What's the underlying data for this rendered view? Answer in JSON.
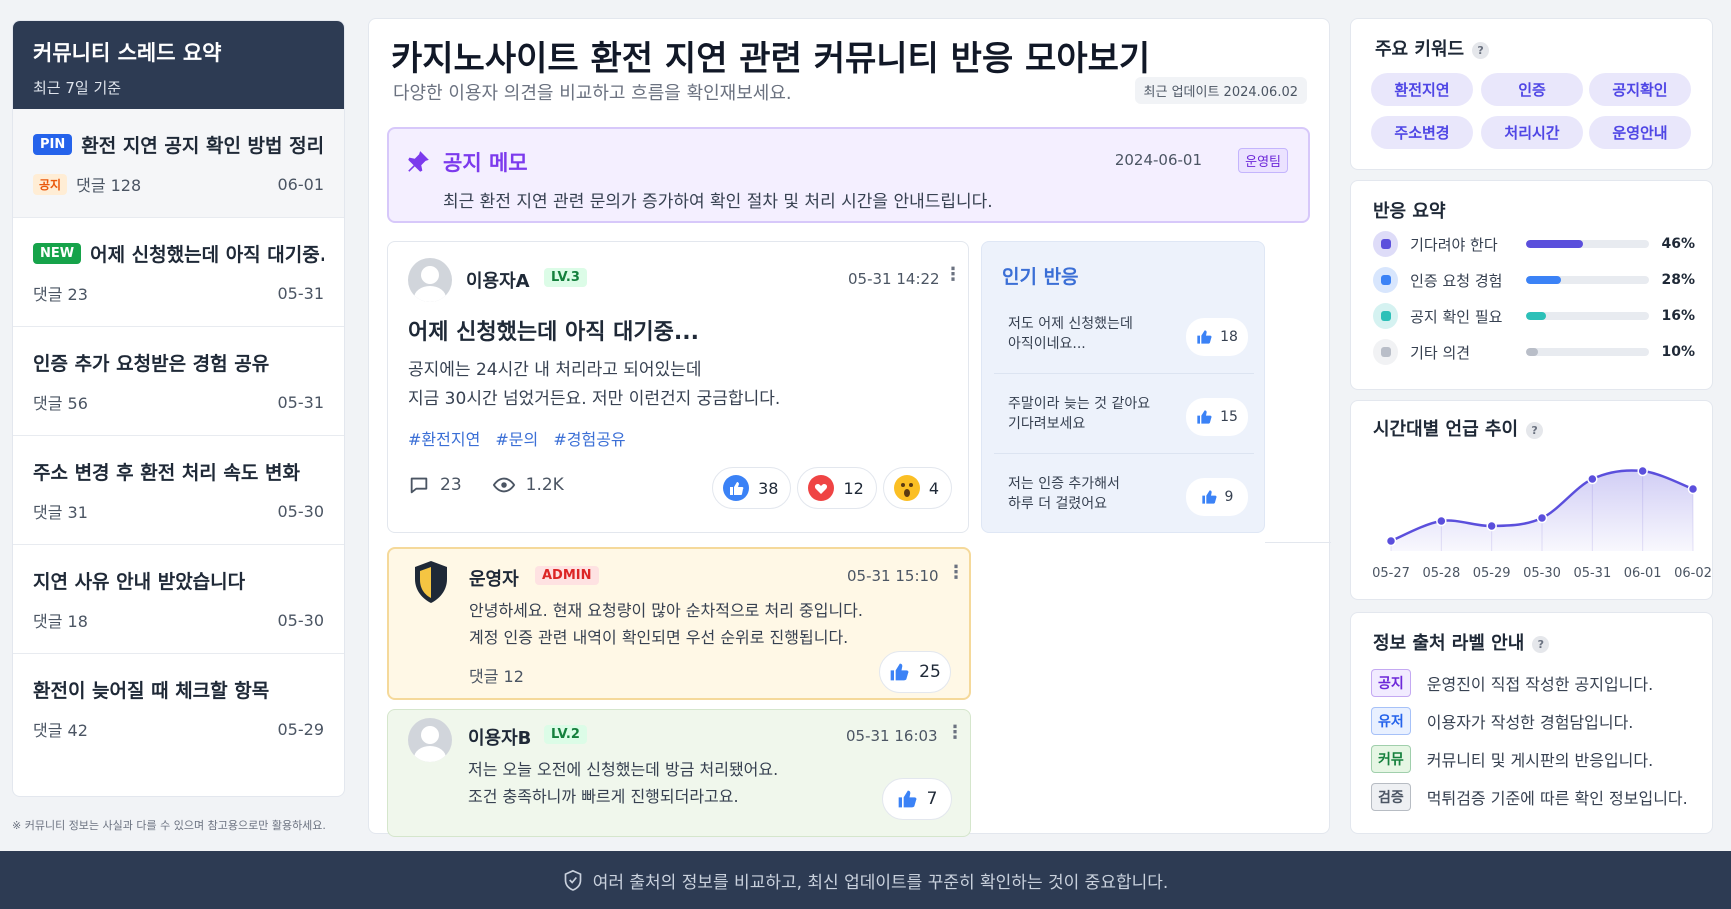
{
  "left": {
    "title": "커뮤니티 스레드 요약",
    "subtitle": "최근 7일 기준",
    "threads": [
      {
        "badge": "PIN",
        "title": "환전 지연 공지 확인 방법 정리",
        "tag": "공지",
        "comments": "댓글 128",
        "date": "06-01"
      },
      {
        "badge": "NEW",
        "title": "어제 신청했는데 아직 대기중...",
        "comments": "댓글 23",
        "date": "05-31"
      },
      {
        "title": "인증 추가 요청받은 경험 공유",
        "comments": "댓글 56",
        "date": "05-31"
      },
      {
        "title": "주소 변경 후 환전 처리 속도 변화",
        "comments": "댓글 31",
        "date": "05-30"
      },
      {
        "title": "지연 사유 안내 받았습니다",
        "comments": "댓글 18",
        "date": "05-30"
      },
      {
        "title": "환전이 늦어질 때 체크할 항목",
        "comments": "댓글 42",
        "date": "05-29"
      }
    ],
    "note": "※ 커뮤니티 정보는 사실과 다를 수 있으며 참고용으로만 활용하세요."
  },
  "main": {
    "title": "카지노사이트 환전 지연 관련 커뮤니티 반응 모아보기",
    "subtitle": "다양한 이용자 의견을 비교하고 흐름을 확인재보세요.",
    "updated": "최근 업데이트 2024.06.02",
    "notice": {
      "title": "공지 메모",
      "date": "2024-06-01",
      "team": "운영팀",
      "body": "최근 환전 지연 관련 문의가 증가하여 확인 절차 및 처리 시간을 안내드립니다."
    },
    "post": {
      "user": "이용자A",
      "level": "LV.3",
      "time": "05-31 14:22",
      "title": "어제 신청했는데 아직 대기중...",
      "body1": "공지에는 24시간 내 처리라고 되어있는데",
      "body2": "지금 30시간 넘었거든요. 저만 이런건지 궁금합니다.",
      "tags": [
        "#환전지연",
        "#문의",
        "#경험공유"
      ],
      "comments": "23",
      "views": "1.2K",
      "reactions": {
        "like": "38",
        "heart": "12",
        "wow": "4"
      }
    },
    "popular": {
      "title": "인기 반응",
      "items": [
        {
          "l1": "저도 어제 신청했는데",
          "l2": "아직이네요...",
          "likes": "18"
        },
        {
          "l1": "주말이라 늦는 것 같아요",
          "l2": "기다려보세요",
          "likes": "15"
        },
        {
          "l1": "저는 인증 추가해서",
          "l2": "하루 더 걸렸어요",
          "likes": "9"
        }
      ]
    },
    "admin_reply": {
      "user": "운영자",
      "badge": "ADMIN",
      "time": "05-31 15:10",
      "body1": "안녕하세요. 현재 요청량이 많아 순차적으로 처리 중입니다.",
      "body2": "계정 인증 관련 내역이 확인되면 우선 순위로 진행됩니다.",
      "comments": "댓글 12",
      "likes": "25"
    },
    "reply_b": {
      "user": "이용자B",
      "level": "LV.2",
      "time": "05-31 16:03",
      "body1": "저는 오늘 오전에 신청했는데 방금 처리됐어요.",
      "body2": "조건 충족하니까 빠르게 진행되더라고요.",
      "likes": "7"
    }
  },
  "keywords": {
    "title": "주요 키워드",
    "help": "?",
    "items": [
      "환전지연",
      "인증",
      "공지확인",
      "주소변경",
      "처리시간",
      "운영안내"
    ]
  },
  "response_summary": {
    "title": "반응 요약",
    "items": [
      {
        "label": "기다려야 한다",
        "value": 46,
        "pct": "46%",
        "color": "#5b4fdc"
      },
      {
        "label": "인증 요청 경험",
        "value": 28,
        "pct": "28%",
        "color": "#3b82f6"
      },
      {
        "label": "공지 확인 필요",
        "value": 16,
        "pct": "16%",
        "color": "#2cc0b8"
      },
      {
        "label": "기타 의견",
        "value": 10,
        "pct": "10%",
        "color": "#b9bec8"
      }
    ]
  },
  "trend": {
    "title": "시간대별 언급 추이",
    "help": "?",
    "chart_data": {
      "type": "area",
      "categories": [
        "05-27",
        "05-28",
        "05-29",
        "05-30",
        "05-31",
        "06-01",
        "06-02"
      ],
      "values": [
        10,
        30,
        25,
        33,
        72,
        80,
        62
      ],
      "ylim": [
        0,
        100
      ],
      "color": "#5b4fdc"
    }
  },
  "source_labels": {
    "title": "정보 출처 라벨 안내",
    "help": "?",
    "items": [
      {
        "tag": "공지",
        "desc": "운영진이 직접 작성한 공지입니다.",
        "color": "#6d28d9",
        "bg": "#f1ebff"
      },
      {
        "tag": "유저",
        "desc": "이용자가 작성한 경험담입니다.",
        "color": "#2563eb",
        "bg": "#e8f0ff"
      },
      {
        "tag": "커뮤",
        "desc": "커뮤니티 및 게시판의 반응입니다.",
        "color": "#15803d",
        "bg": "#e6f6e4"
      },
      {
        "tag": "검증",
        "desc": "먹튀검증 기준에 따른 확인 정보입니다.",
        "color": "#4b5563",
        "bg": "#eef0f3"
      }
    ]
  },
  "footer": {
    "text": "여러 출처의 정보를 비교하고, 최신 업데이트를 꾸준히 확인하는 것이 중요합니다."
  }
}
